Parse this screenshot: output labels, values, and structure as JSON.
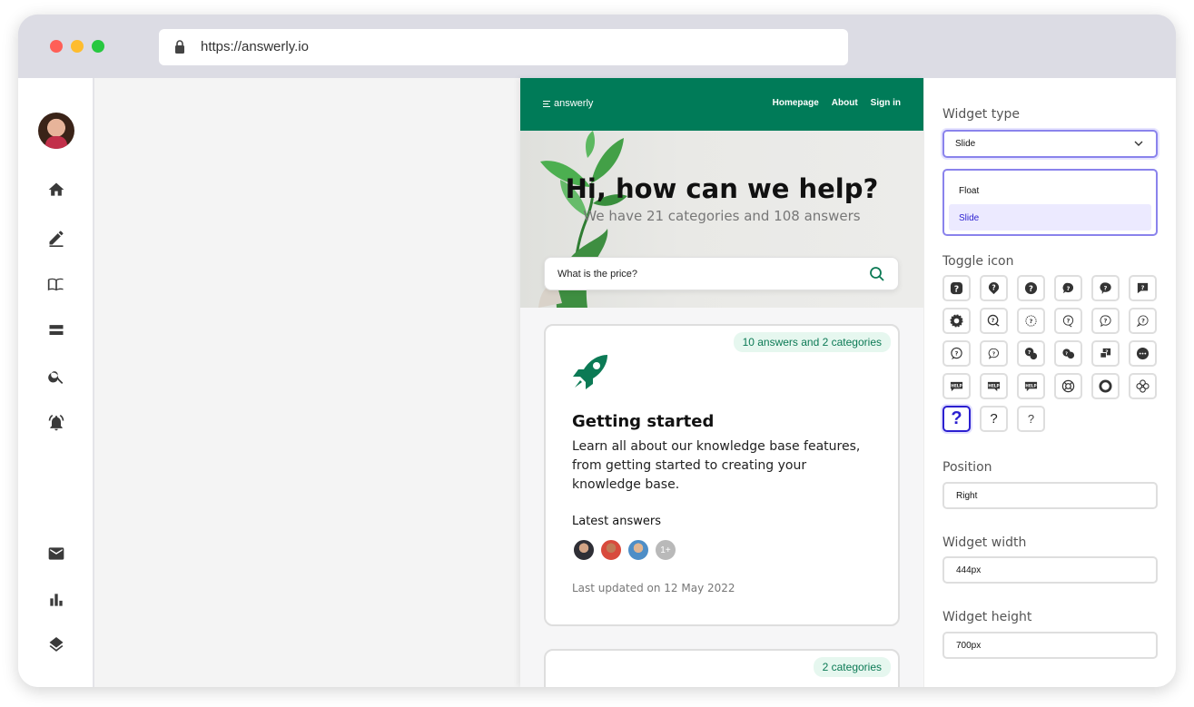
{
  "browser": {
    "url": "https://answerly.io"
  },
  "preview": {
    "logo": "answerly",
    "nav": [
      "Homepage",
      "About",
      "Sign in"
    ],
    "hero": {
      "title": "Hi, how can we help?",
      "subtitle": "We have 21 categories and 108 answers",
      "search_value": "What is the price?"
    },
    "cards": [
      {
        "badge": "10 answers and 2 categories",
        "title": "Getting started",
        "description": "Learn all about our knowledge base features, from getting started to creating your knowledge base.",
        "latest_label": "Latest answers",
        "more_count": "1+",
        "updated": "Last updated on 12 May 2022"
      },
      {
        "badge": "2 categories"
      }
    ]
  },
  "panel": {
    "widget_type_label": "Widget type",
    "widget_type_value": "Slide",
    "widget_type_options": [
      "Float",
      "Slide"
    ],
    "toggle_icon_label": "Toggle icon",
    "help_text": "HELP",
    "question_glyph": "?",
    "position_label": "Position",
    "position_value": "Right",
    "width_label": "Widget width",
    "width_value": "444px",
    "height_label": "Widget height",
    "height_value": "700px"
  },
  "colors": {
    "brand_green": "#007b58",
    "accent_purple": "#2b1fd0"
  }
}
